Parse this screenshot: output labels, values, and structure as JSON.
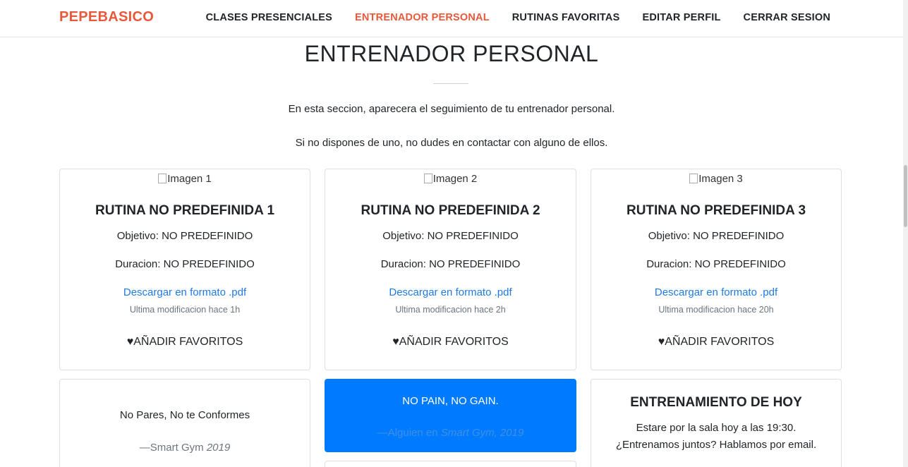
{
  "nav": {
    "brand": "PEPEBASICO",
    "items": [
      {
        "label": "CLASES PRESENCIALES"
      },
      {
        "label": "ENTRENADOR PERSONAL",
        "active": true
      },
      {
        "label": "RUTINAS FAVORITAS"
      },
      {
        "label": "EDITAR PERFIL"
      },
      {
        "label": "CERRAR SESION"
      }
    ]
  },
  "section": {
    "title": "ENTRENADOR PERSONAL",
    "intro1": "En esta seccion, aparecera el seguimiento de tu entrenador personal.",
    "intro2": "Si no dispones de uno, no dudes en contactar con alguno de ellos."
  },
  "routines": [
    {
      "img_alt": "Imagen 1",
      "title": "RUTINA NO PREDEFINIDA 1",
      "objetivo": "Objetivo: NO PREDEFINIDO",
      "duracion": "Duracion: NO PREDEFINIDO",
      "link": "Descargar en formato .pdf",
      "modified": "Ultima modificacion hace 1h",
      "fav": "♥AÑADIR FAVORITOS"
    },
    {
      "img_alt": "Imagen 2",
      "title": "RUTINA NO PREDEFINIDA 2",
      "objetivo": "Objetivo: NO PREDEFINIDO",
      "duracion": "Duracion: NO PREDEFINIDO",
      "link": "Descargar en formato .pdf",
      "modified": "Ultima modificacion hace 2h",
      "fav": "♥AÑADIR FAVORITOS"
    },
    {
      "img_alt": "Imagen 3",
      "title": "RUTINA NO PREDEFINIDA 3",
      "objetivo": "Objetivo: NO PREDEFINIDO",
      "duracion": "Duracion: NO PREDEFINIDO",
      "link": "Descargar en formato .pdf",
      "modified": "Ultima modificacion hace 20h",
      "fav": "♥AÑADIR FAVORITOS"
    }
  ],
  "quote1": {
    "text": "No Pares, No te Conformes",
    "source": "Smart Gym",
    "year": "2019"
  },
  "quote2": {
    "text": "NO PAIN, NO GAIN.",
    "prefix": "Alguien en",
    "source": "Smart Gym, 2019"
  },
  "today": {
    "title": "ENTRENAMIENTO DE HOY",
    "line1": "Estare por la sala hoy a las 19:30.",
    "line2": "¿Entrenamos juntos? Hablamos por email."
  },
  "colors": {
    "accent": "#e8583a",
    "link": "#1f7ae6",
    "primary": "#007bff"
  }
}
